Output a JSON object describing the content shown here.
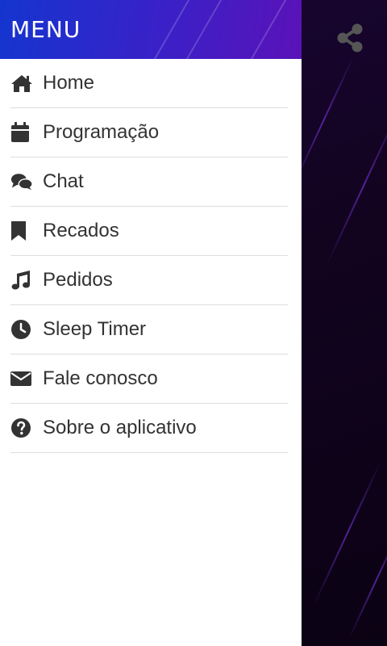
{
  "drawer": {
    "title": "MENU",
    "items": [
      {
        "label": "Home",
        "icon": "home-icon"
      },
      {
        "label": "Programação",
        "icon": "calendar-icon"
      },
      {
        "label": "Chat",
        "icon": "chat-icon"
      },
      {
        "label": "Recados",
        "icon": "bookmark-icon"
      },
      {
        "label": "Pedidos",
        "icon": "music-icon"
      },
      {
        "label": "Sleep Timer",
        "icon": "clock-icon"
      },
      {
        "label": "Fale conosco",
        "icon": "envelope-icon"
      },
      {
        "label": "Sobre o aplicativo",
        "icon": "question-circle-icon"
      }
    ]
  },
  "topbar": {
    "share_icon": "share-icon"
  },
  "colors": {
    "header_start": "#1435cf",
    "header_end": "#5a12b8",
    "background_dark": "#12031f",
    "menu_text": "#333333",
    "divider": "#dddddd",
    "share_icon": "#555555"
  }
}
